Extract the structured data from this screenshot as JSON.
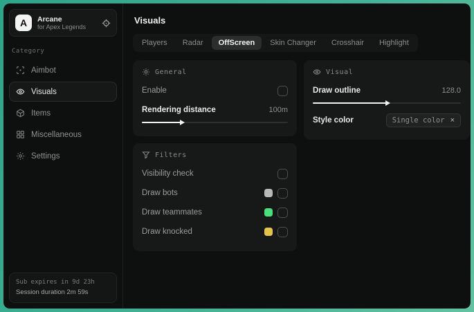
{
  "sidebar": {
    "logo": {
      "initial": "A",
      "title": "Arcane",
      "subtitle": "for Apex Legends"
    },
    "category_label": "Category",
    "items": [
      {
        "label": "Aimbot"
      },
      {
        "label": "Visuals"
      },
      {
        "label": "Items"
      },
      {
        "label": "Miscellaneous"
      },
      {
        "label": "Settings"
      }
    ],
    "footer": {
      "line1": "Sub expires in 9d 23h",
      "line2": "Session duration 2m 59s"
    }
  },
  "header": {
    "title": "Visuals"
  },
  "tabs": [
    {
      "label": "Players"
    },
    {
      "label": "Radar"
    },
    {
      "label": "OffScreen"
    },
    {
      "label": "Skin Changer"
    },
    {
      "label": "Crosshair"
    },
    {
      "label": "Highlight"
    }
  ],
  "active_tab": "OffScreen",
  "panels": {
    "general": {
      "title": "General",
      "enable_label": "Enable",
      "rendering_label": "Rendering distance",
      "rendering_value": "100m",
      "rendering_percent": 27
    },
    "filters": {
      "title": "Filters",
      "rows": [
        {
          "label": "Visibility check"
        },
        {
          "label": "Draw bots",
          "swatch": "#b8bab9"
        },
        {
          "label": "Draw teammates",
          "swatch": "#4ade7c"
        },
        {
          "label": "Draw knocked",
          "swatch": "#e4c34d"
        }
      ]
    },
    "visual": {
      "title": "Visual",
      "outline_label": "Draw outline",
      "outline_value": "128.0",
      "outline_percent": 50,
      "style_label": "Style color",
      "style_value": "Single color",
      "style_clear": "×"
    }
  },
  "colors": {
    "accent_teal": "#44b294",
    "window_bg": "#0e100f",
    "panel_bg": "#171918",
    "active_pill": "#2c2e2d",
    "text_primary": "#e8eae9",
    "text_secondary": "#8f9190",
    "swatch_bots": "#b8bab9",
    "swatch_teammates": "#4ade7c",
    "swatch_knocked": "#e4c34d"
  }
}
